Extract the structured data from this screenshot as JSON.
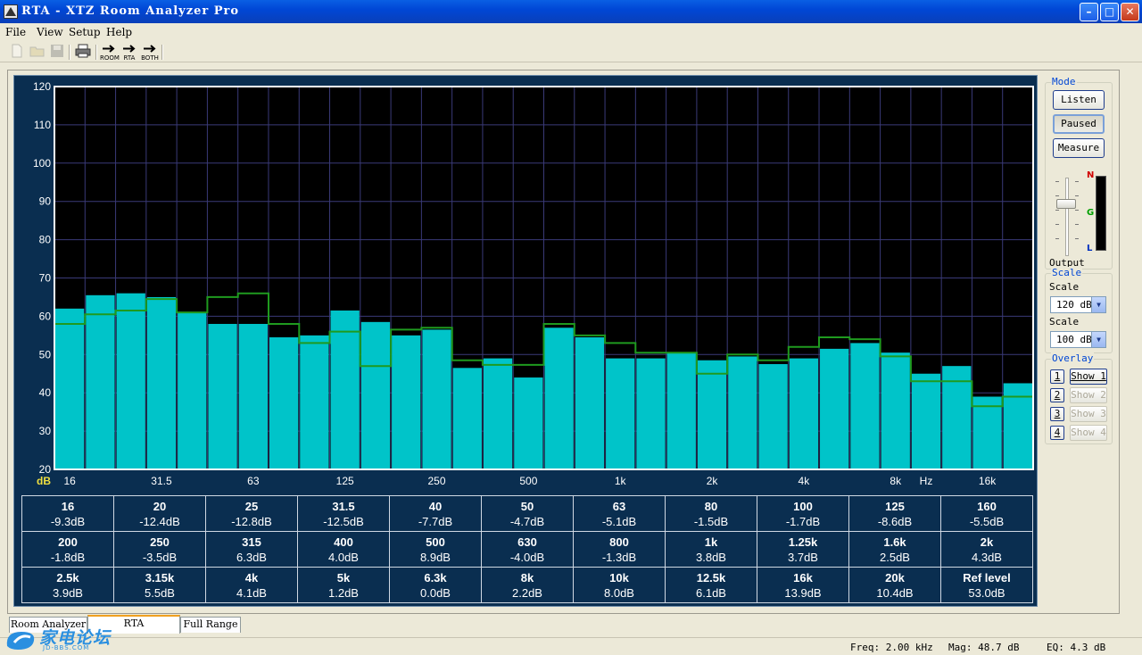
{
  "window": {
    "title": "RTA - XTZ Room Analyzer Pro"
  },
  "menu": [
    "File",
    "View",
    "Setup",
    "Help"
  ],
  "toolbar": {
    "room_label": "ROOM",
    "rta_label": "RTA",
    "both_label": "BOTH"
  },
  "panel": {
    "mode_label": "Mode",
    "listen": "Listen",
    "paused": "Paused",
    "measure": "Measure",
    "meter_n": "N",
    "meter_g": "G",
    "meter_l": "L",
    "output_label": "Output",
    "scale_group": "Scale",
    "scale1_label": "Scale",
    "scale1_value": "120 dB",
    "scale2_label": "Scale",
    "scale2_value": "100 dB",
    "overlay_label": "Overlay",
    "overlays": [
      {
        "num": "1",
        "show": "Show 1",
        "enabled": true
      },
      {
        "num": "2",
        "show": "Show 2",
        "enabled": false
      },
      {
        "num": "3",
        "show": "Show 3",
        "enabled": false
      },
      {
        "num": "4",
        "show": "Show 4",
        "enabled": false
      }
    ]
  },
  "chart_data": {
    "type": "bar",
    "ylim": [
      20,
      120
    ],
    "y_ticks": [
      20,
      30,
      40,
      50,
      60,
      70,
      80,
      90,
      100,
      110,
      120
    ],
    "grid": true,
    "unit_left": "dB",
    "unit_right": "Hz",
    "x_tick_labels": [
      {
        "band": 0,
        "label": "16"
      },
      {
        "band": 3,
        "label": "31.5"
      },
      {
        "band": 6,
        "label": "63"
      },
      {
        "band": 9,
        "label": "125"
      },
      {
        "band": 12,
        "label": "250"
      },
      {
        "band": 15,
        "label": "500"
      },
      {
        "band": 18,
        "label": "1k"
      },
      {
        "band": 21,
        "label": "2k"
      },
      {
        "band": 24,
        "label": "4k"
      },
      {
        "band": 27,
        "label": "8k"
      },
      {
        "band": 30,
        "label": "16k"
      }
    ],
    "series": [
      {
        "values": [
          62,
          65.5,
          66,
          65,
          61,
          58,
          58,
          54.5,
          55,
          61.5,
          58.5,
          55,
          56.5,
          46.5,
          49,
          44,
          57,
          54.5,
          49,
          49,
          50.5,
          48.5,
          49.5,
          47.5,
          49,
          51.5,
          53,
          50.5,
          45,
          47,
          39,
          42.5
        ],
        "color": "#00c4c9"
      },
      {
        "values": [
          58,
          60.5,
          61.5,
          64.5,
          61,
          65,
          66,
          58,
          53,
          56,
          47,
          56.5,
          57,
          48.5,
          47.3,
          47.3,
          58,
          55,
          53,
          50.5,
          50.5,
          45,
          50,
          48.5,
          52,
          54.5,
          54,
          49.5,
          43,
          43,
          36.5,
          39
        ],
        "color": "#1f9a1f"
      }
    ]
  },
  "readings": [
    [
      {
        "band": "16",
        "val": "-9.3dB"
      },
      {
        "band": "20",
        "val": "-12.4dB"
      },
      {
        "band": "25",
        "val": "-12.8dB"
      },
      {
        "band": "31.5",
        "val": "-12.5dB"
      },
      {
        "band": "40",
        "val": "-7.7dB"
      },
      {
        "band": "50",
        "val": "-4.7dB"
      },
      {
        "band": "63",
        "val": "-5.1dB"
      },
      {
        "band": "80",
        "val": "-1.5dB"
      },
      {
        "band": "100",
        "val": "-1.7dB"
      },
      {
        "band": "125",
        "val": "-8.6dB"
      },
      {
        "band": "160",
        "val": "-5.5dB"
      }
    ],
    [
      {
        "band": "200",
        "val": "-1.8dB"
      },
      {
        "band": "250",
        "val": "-3.5dB"
      },
      {
        "band": "315",
        "val": "6.3dB"
      },
      {
        "band": "400",
        "val": "4.0dB"
      },
      {
        "band": "500",
        "val": "8.9dB"
      },
      {
        "band": "630",
        "val": "-4.0dB"
      },
      {
        "band": "800",
        "val": "-1.3dB"
      },
      {
        "band": "1k",
        "val": "3.8dB"
      },
      {
        "band": "1.25k",
        "val": "3.7dB"
      },
      {
        "band": "1.6k",
        "val": "2.5dB"
      },
      {
        "band": "2k",
        "val": "4.3dB"
      }
    ],
    [
      {
        "band": "2.5k",
        "val": "3.9dB"
      },
      {
        "band": "3.15k",
        "val": "5.5dB"
      },
      {
        "band": "4k",
        "val": "4.1dB"
      },
      {
        "band": "5k",
        "val": "1.2dB"
      },
      {
        "band": "6.3k",
        "val": "0.0dB"
      },
      {
        "band": "8k",
        "val": "2.2dB"
      },
      {
        "band": "10k",
        "val": "8.0dB"
      },
      {
        "band": "12.5k",
        "val": "6.1dB"
      },
      {
        "band": "16k",
        "val": "13.9dB"
      },
      {
        "band": "20k",
        "val": "10.4dB"
      },
      {
        "band": "Ref level",
        "val": "53.0dB"
      }
    ]
  ],
  "tabs": [
    "Room Analyzer",
    "RTA",
    "Full Range"
  ],
  "status": {
    "freq": "Freq: 2.00 kHz",
    "mag": "Mag: 48.7 dB",
    "eq": "EQ: 4.3 dB"
  },
  "watermark": {
    "main": "家电论坛",
    "sub": "JD-BBS.COM"
  }
}
